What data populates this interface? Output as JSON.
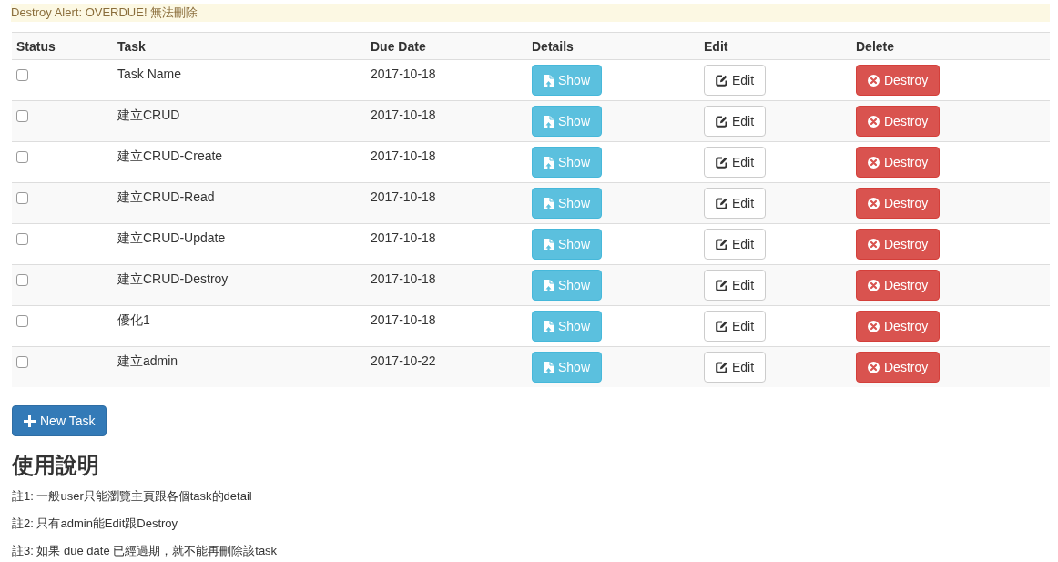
{
  "alert": {
    "text": "Destroy Alert: OVERDUE! 無法刪除"
  },
  "table": {
    "columns": [
      "Status",
      "Task",
      "Due Date",
      "Details",
      "Edit",
      "Delete"
    ],
    "rows": [
      {
        "checked": false,
        "task": "Task Name",
        "due_date": "2017-10-18",
        "show": "Show",
        "edit": "Edit",
        "destroy": "Destroy"
      },
      {
        "checked": false,
        "task": "建立CRUD",
        "due_date": "2017-10-18",
        "show": "Show",
        "edit": "Edit",
        "destroy": "Destroy"
      },
      {
        "checked": false,
        "task": "建立CRUD-Create",
        "due_date": "2017-10-18",
        "show": "Show",
        "edit": "Edit",
        "destroy": "Destroy"
      },
      {
        "checked": false,
        "task": "建立CRUD-Read",
        "due_date": "2017-10-18",
        "show": "Show",
        "edit": "Edit",
        "destroy": "Destroy"
      },
      {
        "checked": false,
        "task": "建立CRUD-Update",
        "due_date": "2017-10-18",
        "show": "Show",
        "edit": "Edit",
        "destroy": "Destroy"
      },
      {
        "checked": false,
        "task": "建立CRUD-Destroy",
        "due_date": "2017-10-18",
        "show": "Show",
        "edit": "Edit",
        "destroy": "Destroy"
      },
      {
        "checked": false,
        "task": "優化1",
        "due_date": "2017-10-18",
        "show": "Show",
        "edit": "Edit",
        "destroy": "Destroy"
      },
      {
        "checked": false,
        "task": "建立admin",
        "due_date": "2017-10-22",
        "show": "Show",
        "edit": "Edit",
        "destroy": "Destroy"
      }
    ]
  },
  "new_task_button": {
    "label": "New Task"
  },
  "help": {
    "title": "使用說明",
    "notes": [
      "註1: 一般user只能瀏覽主頁跟各個task的detail",
      "註2: 只有admin能Edit跟Destroy",
      "註3: 如果 due date 已經過期，就不能再刪除該task"
    ]
  }
}
